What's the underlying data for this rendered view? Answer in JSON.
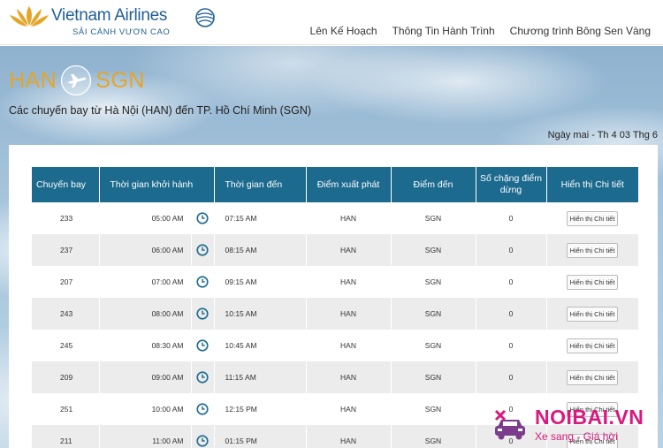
{
  "header": {
    "brand_name": "Vietnam Airlines",
    "tagline": "SẢI CÁNH VƯƠN CAO",
    "nav": [
      "Lên Kế Hoạch",
      "Thông Tin Hành Trình",
      "Chương trình Bông Sen Vàng"
    ]
  },
  "route": {
    "origin": "HAN",
    "destination": "SGN",
    "description": "Các chuyến bay từ Hà Nội (HAN) đến TP. Hồ Chí Minh (SGN)",
    "date": "Ngày mai - Th 4 03 Thg 6"
  },
  "table": {
    "columns": {
      "flight": "Chuyến bay",
      "departure": "Thời gian khởi hành",
      "arrival": "Thời gian đến",
      "origin": "Điểm xuất phát",
      "destination": "Điểm đến",
      "stops": "Số chặng điểm dừng",
      "details": "Hiển thị Chi tiết"
    },
    "detail_button_label": "Hiển thị Chi tiết",
    "rows": [
      {
        "flight": "233",
        "departure": "05:00 AM",
        "arrival": "07:15 AM",
        "origin": "HAN",
        "destination": "SGN",
        "stops": "0"
      },
      {
        "flight": "237",
        "departure": "06:00 AM",
        "arrival": "08:15 AM",
        "origin": "HAN",
        "destination": "SGN",
        "stops": "0"
      },
      {
        "flight": "207",
        "departure": "07:00 AM",
        "arrival": "09:15 AM",
        "origin": "HAN",
        "destination": "SGN",
        "stops": "0"
      },
      {
        "flight": "243",
        "departure": "08:00 AM",
        "arrival": "10:15 AM",
        "origin": "HAN",
        "destination": "SGN",
        "stops": "0"
      },
      {
        "flight": "245",
        "departure": "08:30 AM",
        "arrival": "10:45 AM",
        "origin": "HAN",
        "destination": "SGN",
        "stops": "0"
      },
      {
        "flight": "209",
        "departure": "09:00 AM",
        "arrival": "11:15 AM",
        "origin": "HAN",
        "destination": "SGN",
        "stops": "0"
      },
      {
        "flight": "251",
        "departure": "10:00 AM",
        "arrival": "12:15 PM",
        "origin": "HAN",
        "destination": "SGN",
        "stops": "0"
      },
      {
        "flight": "211",
        "departure": "11:00 AM",
        "arrival": "01:15 PM",
        "origin": "HAN",
        "destination": "SGN",
        "stops": "0"
      }
    ]
  },
  "watermark": {
    "brand": "NOIBAI.VN",
    "tagline": "Xe sang - Giá hời"
  },
  "icons": {
    "logo": "lotus-icon",
    "globe": "globe-icon",
    "route": "plane-icon",
    "clock": "clock-icon",
    "watermark": "car-icon"
  },
  "colors": {
    "brand_blue": "#1f5f93",
    "header_teal": "#1c6a8e",
    "route_gold": "#e5a52a",
    "watermark_pink": "#d9197e"
  }
}
